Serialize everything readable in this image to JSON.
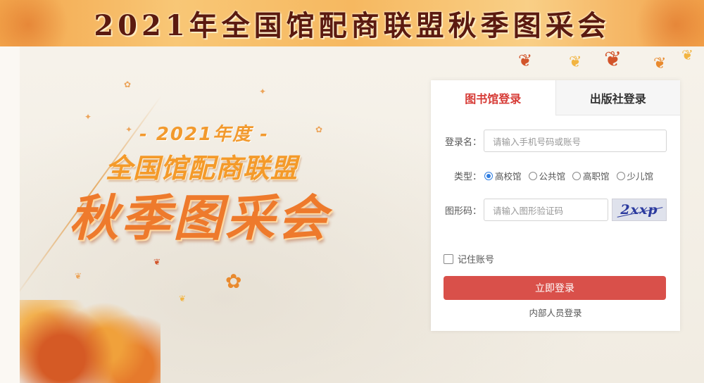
{
  "banner": {
    "title": "2021年全国馆配商联盟秋季图采会"
  },
  "hero": {
    "year_line": "- 2021年度 -",
    "subtitle": "全国馆配商联盟",
    "main_title": "秋季图采会"
  },
  "login": {
    "tabs": [
      {
        "label": "图书馆登录",
        "active": true
      },
      {
        "label": "出版社登录",
        "active": false
      }
    ],
    "username": {
      "label": "登录名：",
      "placeholder": "请输入手机号码或账号"
    },
    "type": {
      "label": "类型：",
      "options": [
        "高校馆",
        "公共馆",
        "高职馆",
        "少儿馆"
      ],
      "selected": "高校馆"
    },
    "captcha": {
      "label": "图形码：",
      "placeholder": "请输入图形验证码",
      "image_text": "2xxp"
    },
    "remember": {
      "label": "记住账号",
      "checked": false
    },
    "submit_label": "立即登录",
    "inner_link": "内部人员登录"
  },
  "colors": {
    "accent": "#d63a35",
    "button": "#d9504a",
    "radio": "#2f7de1",
    "banner_text": "#5b1a10"
  }
}
